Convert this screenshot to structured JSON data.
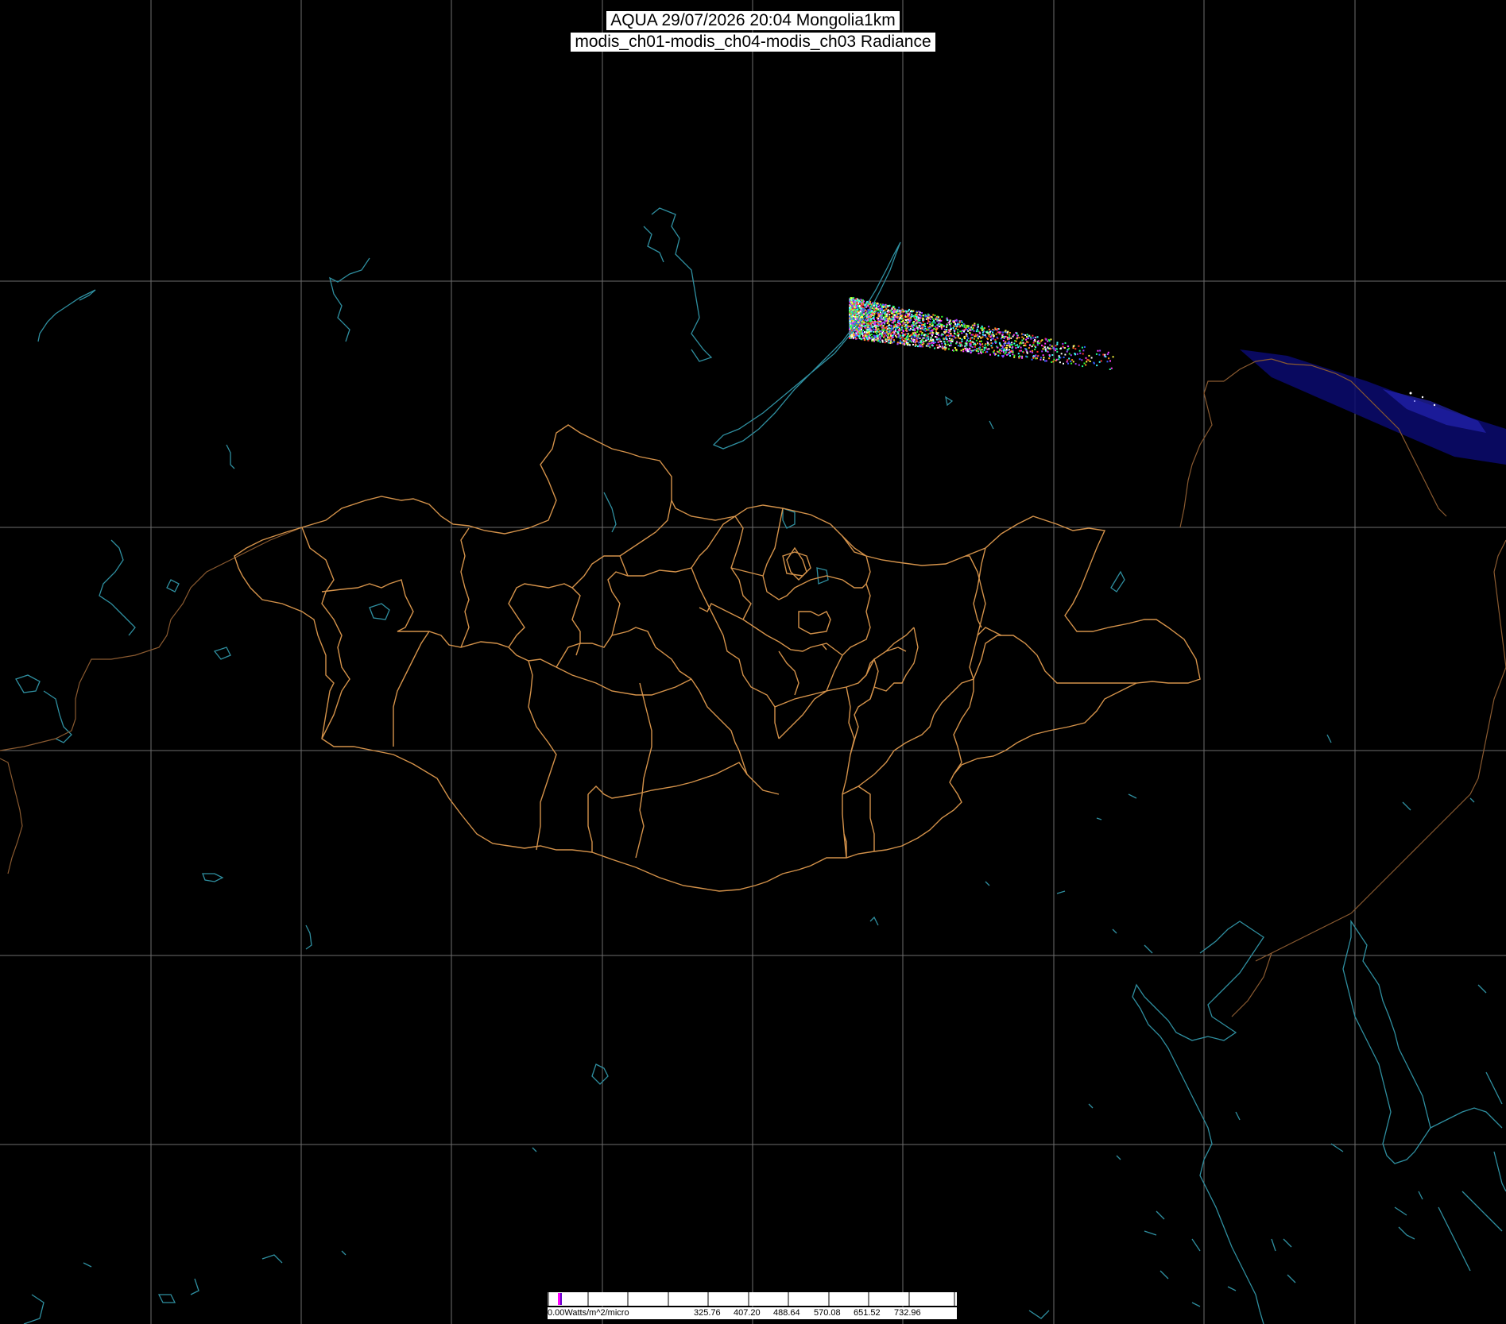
{
  "title": {
    "line1": "AQUA 29/07/2026 20:04 Mongolia1km",
    "line2": "modis_ch01-modis_ch04-modis_ch03 Radiance"
  },
  "colors": {
    "background": "#000000",
    "graticule": "#6e6e6e",
    "province_border": "#d4924a",
    "coastline": "#2f8fa0",
    "swath_blue": "#0a0a70",
    "legend_bg": "#ffffff"
  },
  "legend": {
    "unit_label": "0.00Watts/m^2/micro",
    "ticks": [
      "325.76",
      "407.20",
      "488.64",
      "570.08",
      "651.52",
      "732.96"
    ]
  },
  "icons": {
    "graticule": "grid-lines",
    "swath": "satellite-swath-icon"
  }
}
